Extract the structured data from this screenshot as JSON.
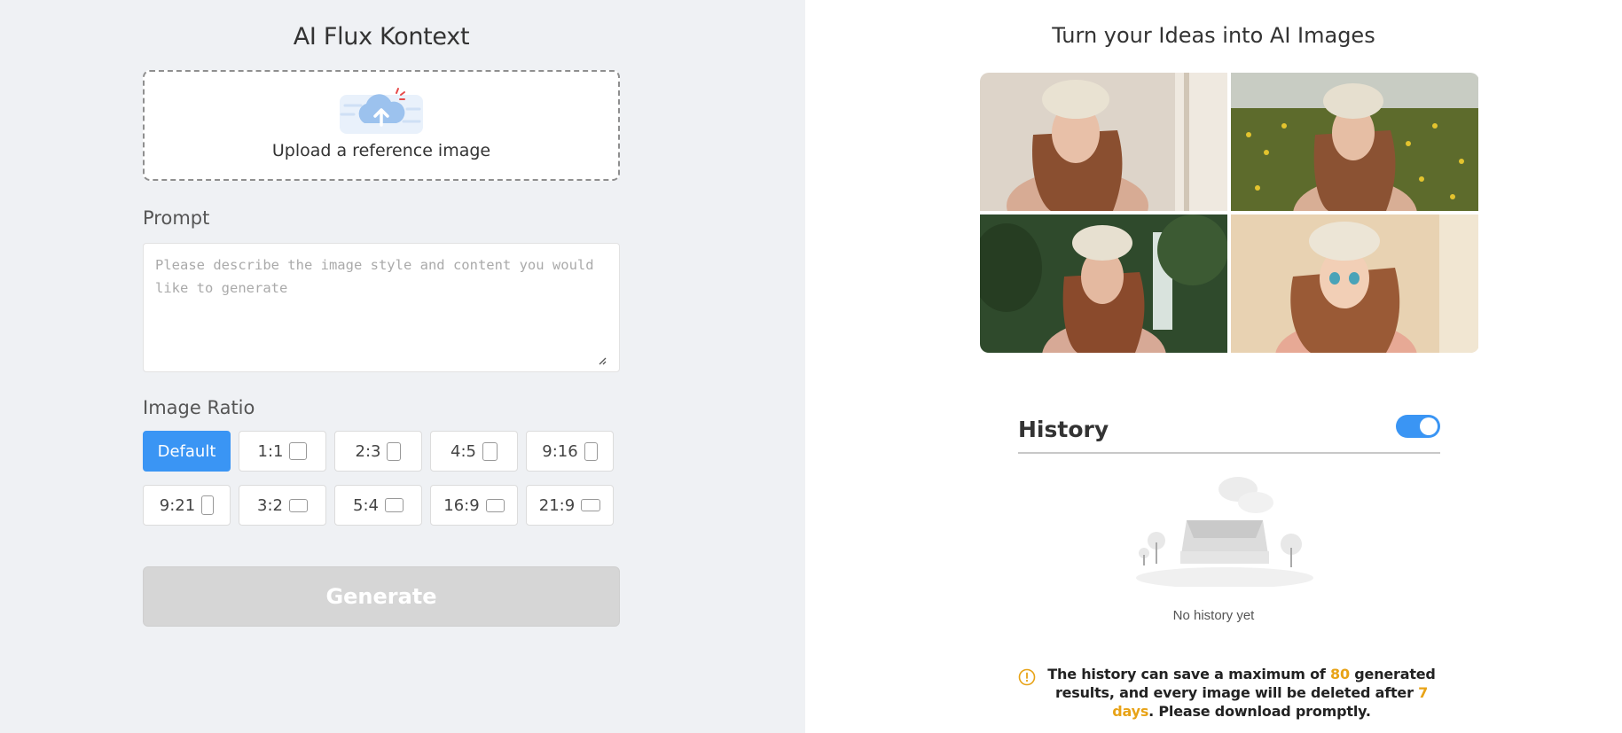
{
  "left": {
    "title": "AI Flux Kontext",
    "upload": {
      "label": "Upload a reference image",
      "icon": "cloud-upload-icon"
    },
    "prompt": {
      "label": "Prompt",
      "placeholder": "Please describe the image style and content you would like to generate",
      "value": ""
    },
    "ratio": {
      "label": "Image Ratio",
      "options": [
        {
          "label": "Default",
          "active": true
        },
        {
          "label": "1:1",
          "shape": [
            1,
            1
          ]
        },
        {
          "label": "2:3",
          "shape": [
            2,
            3
          ]
        },
        {
          "label": "4:5",
          "shape": [
            4,
            5
          ]
        },
        {
          "label": "9:16",
          "shape": [
            9,
            16
          ]
        },
        {
          "label": "9:21",
          "shape": [
            9,
            21
          ]
        },
        {
          "label": "3:2",
          "shape": [
            3,
            2
          ]
        },
        {
          "label": "5:4",
          "shape": [
            5,
            4
          ]
        },
        {
          "label": "16:9",
          "shape": [
            16,
            9
          ]
        },
        {
          "label": "21:9",
          "shape": [
            21,
            9
          ]
        }
      ]
    },
    "generate_label": "Generate"
  },
  "right": {
    "title": "Turn your Ideas into AI Images",
    "gallery": [
      {
        "name": "sample-photo-indoor"
      },
      {
        "name": "sample-photo-flower-field"
      },
      {
        "name": "sample-photo-waterfall"
      },
      {
        "name": "sample-anime-style"
      }
    ],
    "history": {
      "title": "History",
      "toggle_on": true,
      "empty_text": "No history yet",
      "notice": {
        "icon": "warning-circle-icon",
        "part1": "The history can save a maximum of ",
        "max_count": "80",
        "part2": " generated results, and every image will be deleted after ",
        "days": "7 days",
        "part3": ". Please download promptly."
      }
    }
  },
  "colors": {
    "accent": "#3a95f4",
    "highlight": "#e8a317",
    "left_bg": "#eff1f4",
    "disabled": "#d6d6d6"
  }
}
